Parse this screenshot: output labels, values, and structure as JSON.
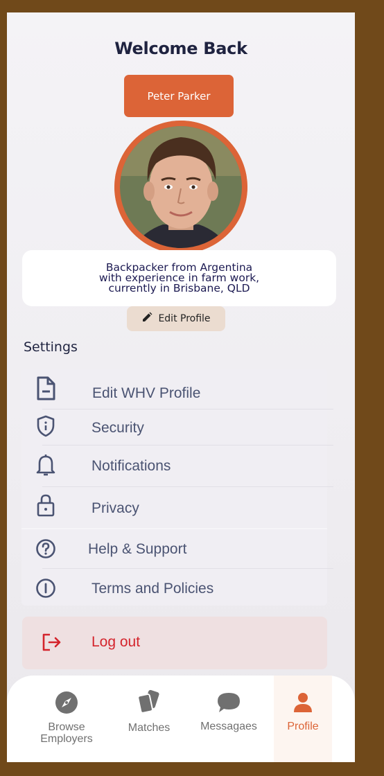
{
  "header": {
    "title": "Welcome Back"
  },
  "profile": {
    "name": "Peter Parker",
    "bio": "Backpacker from Argentina\nwith experience in farm work,\ncurrently in Brisbane, QLD",
    "edit_label": "Edit Profile"
  },
  "settings": {
    "title": "Settings",
    "items": [
      {
        "label": "Edit WHV Profile",
        "icon": "document-icon"
      },
      {
        "label": "Security",
        "icon": "shield-icon"
      },
      {
        "label": "Notifications",
        "icon": "bell-icon"
      },
      {
        "label": "Privacy",
        "icon": "lock-icon"
      },
      {
        "label": "Help & Support",
        "icon": "help-icon"
      },
      {
        "label": "Terms and Policies",
        "icon": "info-icon"
      }
    ],
    "logout_label": "Log out"
  },
  "nav": {
    "tabs": [
      {
        "label": "Browse\nEmployers",
        "icon": "compass-icon"
      },
      {
        "label": "Matches",
        "icon": "cards-icon"
      },
      {
        "label": "Messagaes",
        "icon": "chat-icon"
      },
      {
        "label": "Profile",
        "icon": "person-icon",
        "active": true
      }
    ]
  },
  "colors": {
    "accent": "#dc6437",
    "text_dark": "#1f2340",
    "logout_red": "#d4242c",
    "background": "#70491a"
  }
}
